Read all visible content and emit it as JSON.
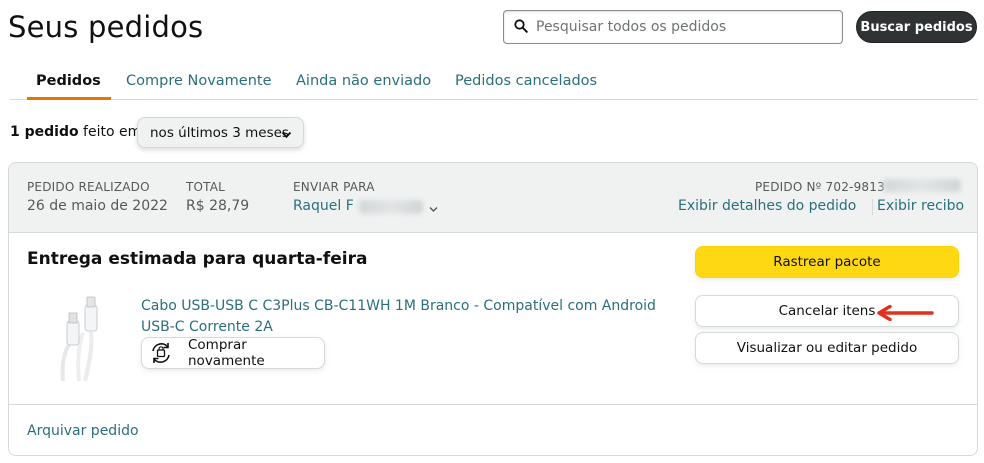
{
  "page": {
    "title": "Seus pedidos"
  },
  "search": {
    "placeholder": "Pesquisar todos os pedidos",
    "button_label": "Buscar pedidos"
  },
  "tabs": [
    {
      "label": "Pedidos",
      "active": true
    },
    {
      "label": "Compre Novamente",
      "active": false
    },
    {
      "label": "Ainda não enviado",
      "active": false
    },
    {
      "label": "Pedidos cancelados",
      "active": false
    }
  ],
  "filter": {
    "count_bold": "1 pedido",
    "count_rest": " feito em",
    "period_selected": "nos últimos 3 meses"
  },
  "order": {
    "placed_label": "PEDIDO REALIZADO",
    "placed_value": "26 de maio de 2022",
    "total_label": "TOTAL",
    "total_value": "R$ 28,79",
    "ship_to_label": "ENVIAR PARA",
    "ship_to_value": "Raquel F",
    "order_number_label": "PEDIDO Nº 702-9813",
    "details_link": "Exibir detalhes do pedido",
    "receipt_link": "Exibir recibo",
    "delivery_status": "Entrega estimada para quarta-feira",
    "product_name": "Cabo USB-USB C C3Plus CB-C11WH 1M Branco - Compatível com Android USB-C Corrente 2A",
    "buy_again_label": "Comprar novamente",
    "track_button": "Rastrear pacote",
    "cancel_button": "Cancelar itens",
    "view_edit_button": "Visualizar ou editar pedido",
    "archive_link": "Arquivar pedido"
  },
  "colors": {
    "link": "#2a6f7c",
    "track_yellow": "#ffd814",
    "tab_underline": "#e77600",
    "annotation_arrow": "#e0301e",
    "dark_button": "#303333"
  }
}
